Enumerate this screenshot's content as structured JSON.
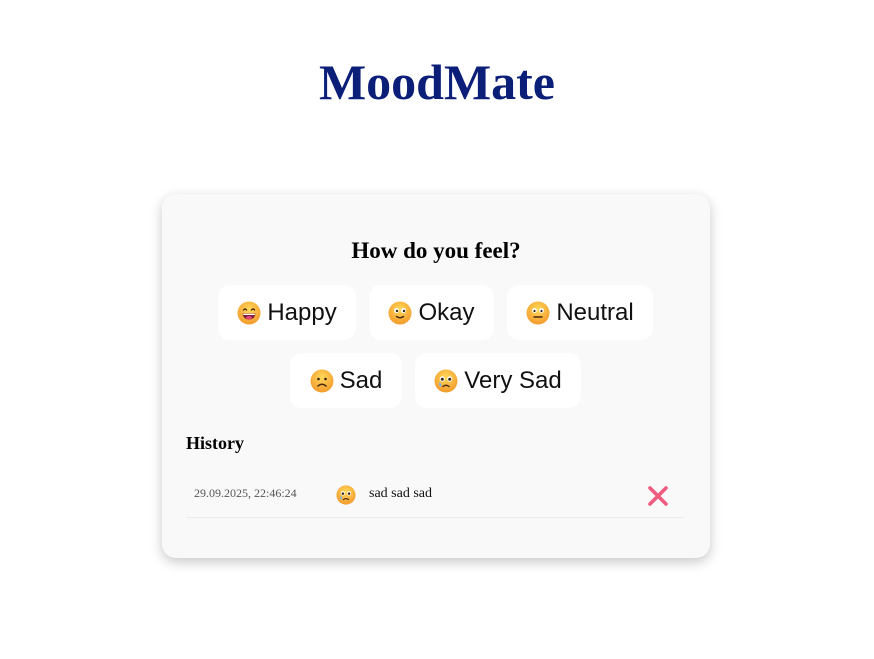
{
  "app": {
    "title": "MoodMate"
  },
  "card": {
    "title": "How do you feel?"
  },
  "moods": [
    {
      "label": "Happy",
      "icon": "grinning-face-icon",
      "color": "#f7b83b"
    },
    {
      "label": "Okay",
      "icon": "smiling-face-icon",
      "color": "#f7b83b"
    },
    {
      "label": "Neutral",
      "icon": "neutral-face-icon",
      "color": "#f7b83b"
    },
    {
      "label": "Sad",
      "icon": "frowning-face-icon",
      "color": "#f7b83b"
    },
    {
      "label": "Very Sad",
      "icon": "crying-face-icon",
      "color": "#f7b83b"
    }
  ],
  "history": {
    "title": "History",
    "entries": [
      {
        "timestamp": "29.09.2025, 22:46:24",
        "mood_icon": "crying-face-icon",
        "note": "sad sad sad",
        "delete_icon": "close-icon"
      }
    ]
  },
  "colors": {
    "title": "#0c1f78",
    "card_bg": "#f9f9f9",
    "delete": "#ef5a7f"
  }
}
